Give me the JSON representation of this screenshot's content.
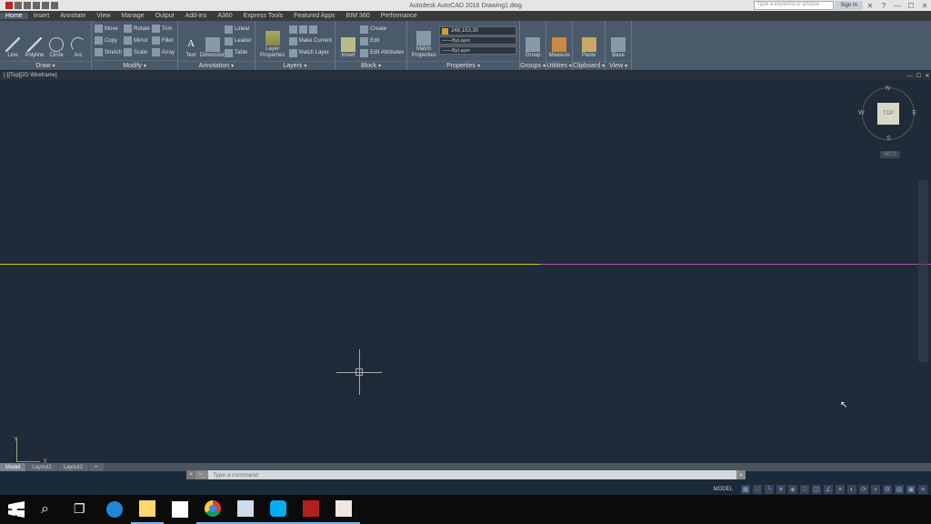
{
  "app": {
    "title": "Autodesk AutoCAD 2016   Drawing1.dwg",
    "search_placeholder": "Type a keyword or phrase",
    "sign_in": "Sign In"
  },
  "menu": [
    "Home",
    "Insert",
    "Annotate",
    "View",
    "Manage",
    "Output",
    "Add-ins",
    "A360",
    "Express Tools",
    "Featured Apps",
    "BIM 360",
    "Performance"
  ],
  "ribbon": {
    "draw": {
      "lbl": "Draw",
      "line": "Line",
      "polyline": "Polyline",
      "circle": "Circle",
      "arc": "Arc"
    },
    "modify": {
      "lbl": "Modify",
      "move": "Move",
      "rotate": "Rotate",
      "trim": "Trim",
      "copy": "Copy",
      "mirror": "Mirror",
      "fillet": "Fillet",
      "stretch": "Stretch",
      "scale": "Scale",
      "array": "Array"
    },
    "annotation": {
      "lbl": "Annotation",
      "text": "Text",
      "dimension": "Dimension",
      "linear": "Linear",
      "leader": "Leader",
      "table": "Table"
    },
    "layers": {
      "lbl": "Layers",
      "properties": "Layer\nProperties",
      "make_current": "Make Current",
      "match": "Match Layer",
      "current": "248,153,30"
    },
    "block": {
      "lbl": "Block",
      "insert": "Insert",
      "create": "Create",
      "edit": "Edit",
      "edit_attr": "Edit Attributes"
    },
    "properties": {
      "lbl": "Properties",
      "match": "Match\nProperties",
      "bylayer": "ByLayer"
    },
    "groups": {
      "lbl": "Groups",
      "group": "Group"
    },
    "utilities": {
      "lbl": "Utilities",
      "measure": "Measure"
    },
    "clipboard": {
      "lbl": "Clipboard",
      "paste": "Paste"
    },
    "view": {
      "lbl": "View",
      "base": "Base"
    }
  },
  "doc_tab": "[-][Top][2D Wireframe]",
  "viewcube": {
    "face": "TOP",
    "wcs": "WCS"
  },
  "ucs": {
    "x": "X",
    "y": "Y"
  },
  "cmd_placeholder": "Type a command",
  "layout_tabs": [
    "Model",
    "Layout1",
    "Layout2"
  ],
  "status_model": "MODEL",
  "compass": {
    "n": "N",
    "e": "E",
    "s": "S",
    "w": "W"
  }
}
